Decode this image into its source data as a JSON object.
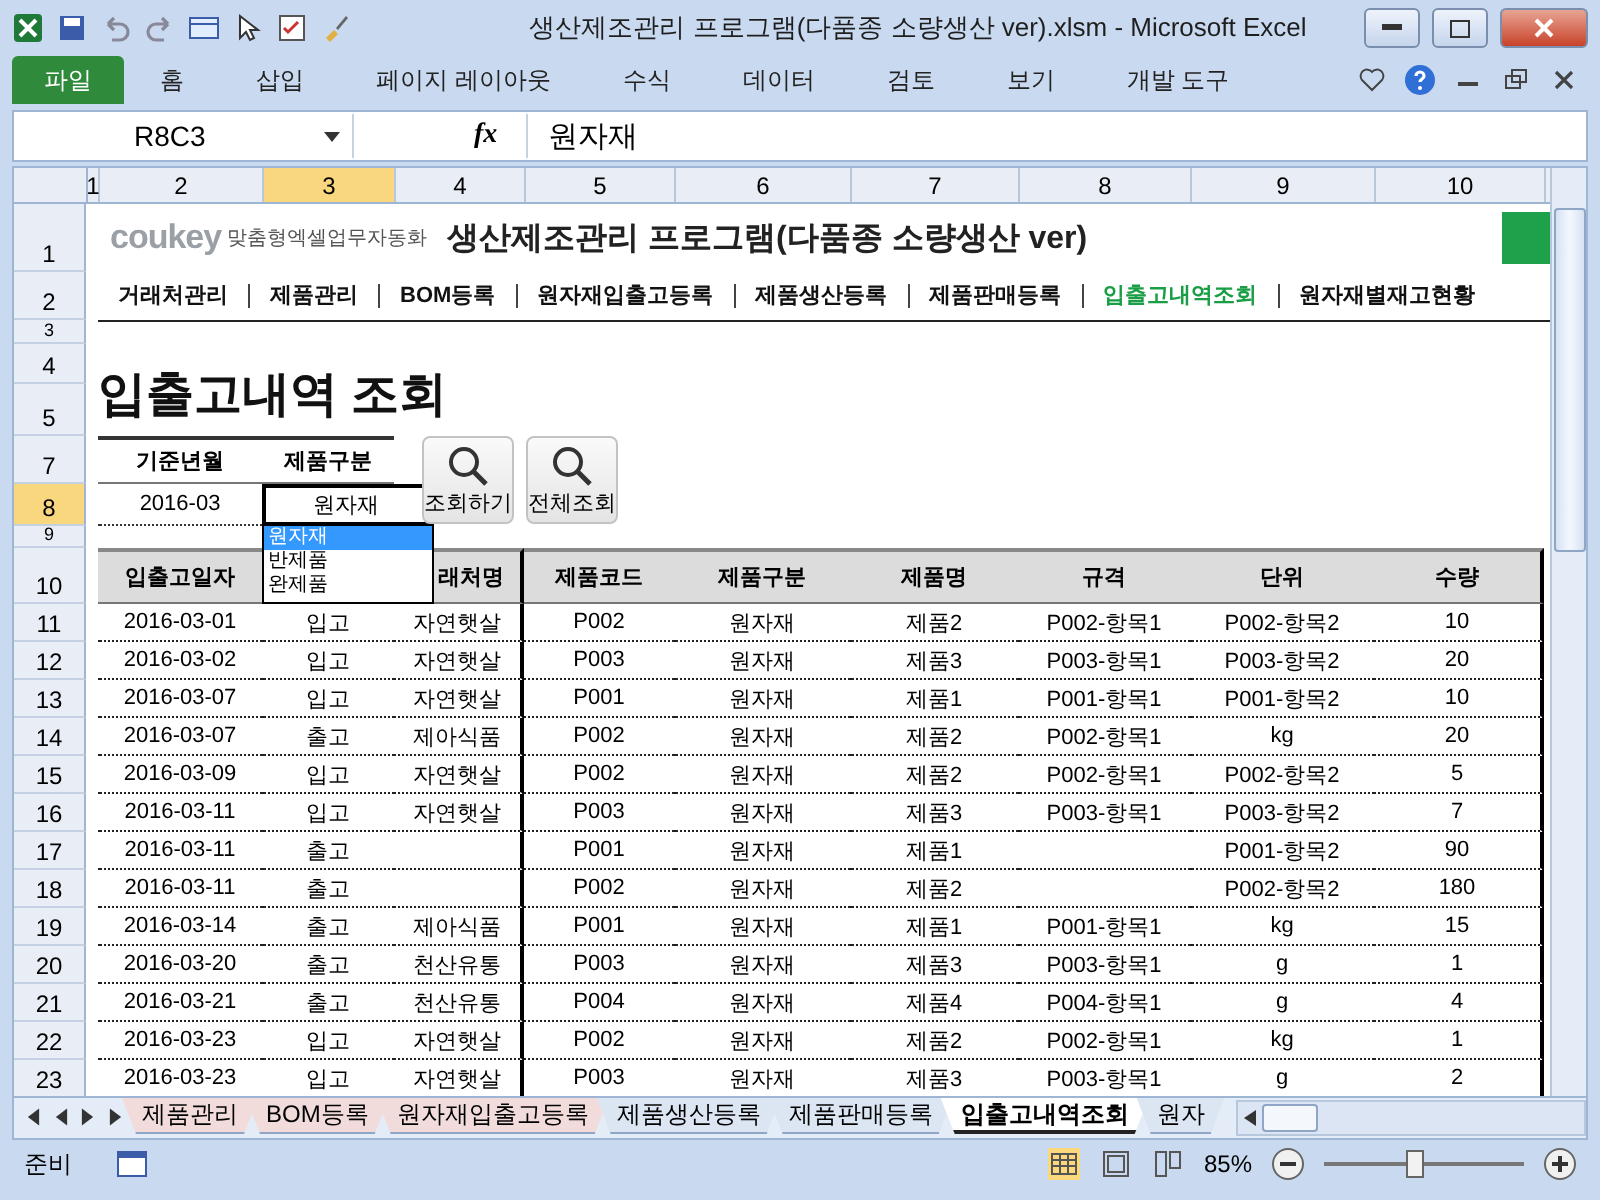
{
  "title_bar": {
    "title": "생산제조관리 프로그램(다품종 소량생산 ver).xlsm  -  Microsoft Excel"
  },
  "ribbon": {
    "file_tab": "파일",
    "tabs": [
      {
        "label": "홈",
        "selected": false
      },
      {
        "label": "삽입",
        "selected": false
      },
      {
        "label": "페이지 레이아웃",
        "selected": false
      },
      {
        "label": "수식",
        "selected": false
      },
      {
        "label": "데이터",
        "selected": false
      },
      {
        "label": "검토",
        "selected": false
      },
      {
        "label": "보기",
        "selected": false
      },
      {
        "label": "개발 도구",
        "selected": false
      }
    ]
  },
  "formula_bar": {
    "name_box": "R8C3",
    "fx": "fx",
    "formula": "원자재"
  },
  "column_headers": [
    {
      "label": "1",
      "selected": false
    },
    {
      "label": "2",
      "selected": false
    },
    {
      "label": "3",
      "selected": true
    },
    {
      "label": "4",
      "selected": false
    },
    {
      "label": "5",
      "selected": false
    },
    {
      "label": "6",
      "selected": false
    },
    {
      "label": "7",
      "selected": false
    },
    {
      "label": "8",
      "selected": false
    },
    {
      "label": "9",
      "selected": false
    },
    {
      "label": "10",
      "selected": false
    }
  ],
  "row_headers": [
    {
      "label": "1",
      "selected": false
    },
    {
      "label": "2",
      "selected": false
    },
    {
      "label": "3",
      "selected": false
    },
    {
      "label": "4",
      "selected": false
    },
    {
      "label": "5",
      "selected": false
    },
    {
      "label": "7",
      "selected": false
    },
    {
      "label": "8",
      "selected": true
    },
    {
      "label": "9",
      "selected": false
    },
    {
      "label": "10",
      "selected": false
    },
    {
      "label": "11",
      "selected": false
    },
    {
      "label": "12",
      "selected": false
    },
    {
      "label": "13",
      "selected": false
    },
    {
      "label": "14",
      "selected": false
    },
    {
      "label": "15",
      "selected": false
    },
    {
      "label": "16",
      "selected": false
    },
    {
      "label": "17",
      "selected": false
    },
    {
      "label": "18",
      "selected": false
    },
    {
      "label": "19",
      "selected": false
    },
    {
      "label": "20",
      "selected": false
    },
    {
      "label": "21",
      "selected": false
    },
    {
      "label": "22",
      "selected": false
    },
    {
      "label": "23",
      "selected": false
    }
  ],
  "sheet": {
    "brand": "coukey",
    "tagline": "맞춤형엑셀업무자동화",
    "program_title": "생산제조관리 프로그램(다품종 소량생산 ver)",
    "nav": [
      {
        "label": "거래처관리",
        "selected": false
      },
      {
        "label": "제품관리",
        "selected": false
      },
      {
        "label": "BOM등록",
        "selected": false
      },
      {
        "label": "원자재입출고등록",
        "selected": false
      },
      {
        "label": "제품생산등록",
        "selected": false
      },
      {
        "label": "제품판매등록",
        "selected": false
      },
      {
        "label": "입출고내역조회",
        "selected": true
      },
      {
        "label": "원자재별재고현황",
        "selected": false
      }
    ],
    "page_title": "입출고내역 조회",
    "filter": {
      "year_month_label": "기준년월",
      "product_type_label": "제품구분",
      "year_month": "2016-03",
      "product_type": "원자재"
    },
    "dropdown_options": [
      {
        "label": "원자재",
        "selected": true
      },
      {
        "label": "반제품",
        "selected": false
      },
      {
        "label": "완제품",
        "selected": false
      }
    ],
    "buttons": [
      "조회하기",
      "전체조회"
    ],
    "table": {
      "columns": [
        "입출고일자",
        null,
        "래처명",
        "제품코드",
        "제품구분",
        "제품명",
        "규격",
        "단위",
        "수량"
      ],
      "rows": [
        {
          "date": "2016-03-01",
          "type": "입고",
          "partner": "자연햇살",
          "code": "P002",
          "category": "원자재",
          "name": "제품2",
          "spec": "P002-항목1",
          "unit": "P002-항목2",
          "qty": "10"
        },
        {
          "date": "2016-03-02",
          "type": "입고",
          "partner": "자연햇살",
          "code": "P003",
          "category": "원자재",
          "name": "제품3",
          "spec": "P003-항목1",
          "unit": "P003-항목2",
          "qty": "20"
        },
        {
          "date": "2016-03-07",
          "type": "입고",
          "partner": "자연햇살",
          "code": "P001",
          "category": "원자재",
          "name": "제품1",
          "spec": "P001-항목1",
          "unit": "P001-항목2",
          "qty": "10"
        },
        {
          "date": "2016-03-07",
          "type": "출고",
          "partner": "제아식품",
          "code": "P002",
          "category": "원자재",
          "name": "제품2",
          "spec": "P002-항목1",
          "unit": "kg",
          "qty": "20"
        },
        {
          "date": "2016-03-09",
          "type": "입고",
          "partner": "자연햇살",
          "code": "P002",
          "category": "원자재",
          "name": "제품2",
          "spec": "P002-항목1",
          "unit": "P002-항목2",
          "qty": "5"
        },
        {
          "date": "2016-03-11",
          "type": "입고",
          "partner": "자연햇살",
          "code": "P003",
          "category": "원자재",
          "name": "제품3",
          "spec": "P003-항목1",
          "unit": "P003-항목2",
          "qty": "7"
        },
        {
          "date": "2016-03-11",
          "type": "출고",
          "code": "P001",
          "category": "원자재",
          "name": "제품1",
          "unit": "P001-항목2",
          "qty": "90"
        },
        {
          "date": "2016-03-11",
          "type": "출고",
          "code": "P002",
          "category": "원자재",
          "name": "제품2",
          "unit": "P002-항목2",
          "qty": "180"
        },
        {
          "date": "2016-03-14",
          "type": "출고",
          "partner": "제아식품",
          "code": "P001",
          "category": "원자재",
          "name": "제품1",
          "spec": "P001-항목1",
          "unit": "kg",
          "qty": "15"
        },
        {
          "date": "2016-03-20",
          "type": "출고",
          "partner": "천산유통",
          "code": "P003",
          "category": "원자재",
          "name": "제품3",
          "spec": "P003-항목1",
          "unit": "g",
          "qty": "1"
        },
        {
          "date": "2016-03-21",
          "type": "출고",
          "partner": "천산유통",
          "code": "P004",
          "category": "원자재",
          "name": "제품4",
          "spec": "P004-항목1",
          "unit": "g",
          "qty": "4"
        },
        {
          "date": "2016-03-23",
          "type": "입고",
          "partner": "자연햇살",
          "code": "P002",
          "category": "원자재",
          "name": "제품2",
          "spec": "P002-항목1",
          "unit": "kg",
          "qty": "1"
        },
        {
          "date": "2016-03-23",
          "type": "입고",
          "partner": "자연햇살",
          "code": "P003",
          "category": "원자재",
          "name": "제품3",
          "spec": "P003-항목1",
          "unit": "g",
          "qty": "2"
        }
      ]
    }
  },
  "sheet_tabs": [
    {
      "label": "제품관리",
      "selected": false,
      "color": "#f2dcdb"
    },
    {
      "label": "BOM등록",
      "selected": false,
      "color": "#f2dcdb"
    },
    {
      "label": "원자재입출고등록",
      "selected": false,
      "color": "#f2dcdb"
    },
    {
      "label": "제품생산등록",
      "selected": false,
      "color": "#dce6f2"
    },
    {
      "label": "제품판매등록",
      "selected": false,
      "color": "#dce6f2"
    },
    {
      "label": "입출고내역조회",
      "selected": true,
      "color": "#ffffff"
    },
    {
      "label": "원자",
      "selected": false,
      "color": "#dce6f2"
    }
  ],
  "status_bar": {
    "ready": "준비",
    "zoom": "85%",
    "zoom_slider": {
      "level": 0.45
    }
  }
}
